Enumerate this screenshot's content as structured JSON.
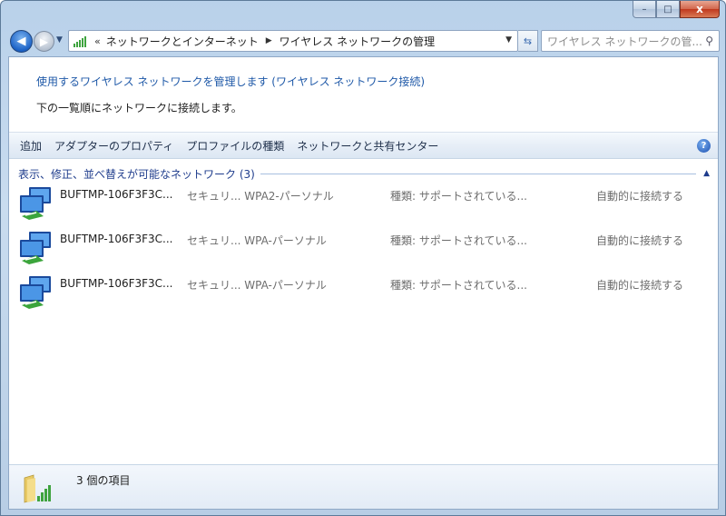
{
  "window": {
    "caption_buttons": {
      "minimize": "–",
      "maximize": "□",
      "close": "x"
    }
  },
  "navigation": {
    "back_icon": "back-arrow-icon",
    "forward_icon": "forward-arrow-icon",
    "breadcrumb": {
      "overflow": "«",
      "items": [
        "ネットワークとインターネット",
        "ワイヤレス ネットワークの管理"
      ]
    },
    "search_placeholder": "ワイヤレス ネットワークの管..."
  },
  "header": {
    "task_link": "使用するワイヤレス ネットワークを管理します (ワイヤレス ネットワーク接続)",
    "description": "下の一覧順にネットワークに接続します。"
  },
  "toolbar": {
    "items": [
      "追加",
      "アダプターのプロパティ",
      "プロファイルの種類",
      "ネットワークと共有センター"
    ],
    "help_label": "?"
  },
  "group": {
    "title": "表示、修正、並べ替えが可能なネットワーク (3)",
    "networks": [
      {
        "name": "BUFTMP-106F3F3C...",
        "security": "セキュリ... WPA2-パーソナル",
        "type": "種類: サポートされている...",
        "mode": "自動的に接続する"
      },
      {
        "name": "BUFTMP-106F3F3C...",
        "security": "セキュリ... WPA-パーソナル",
        "type": "種類: サポートされている...",
        "mode": "自動的に接続する"
      },
      {
        "name": "BUFTMP-106F3F3C...",
        "security": "セキュリ... WPA-パーソナル",
        "type": "種類: サポートされている...",
        "mode": "自動的に接続する"
      }
    ]
  },
  "status": {
    "text": "3 個の項目"
  },
  "colors": {
    "link": "#1f59a8",
    "group_title": "#1e3c8c",
    "signal_green": "#3ea33e"
  }
}
